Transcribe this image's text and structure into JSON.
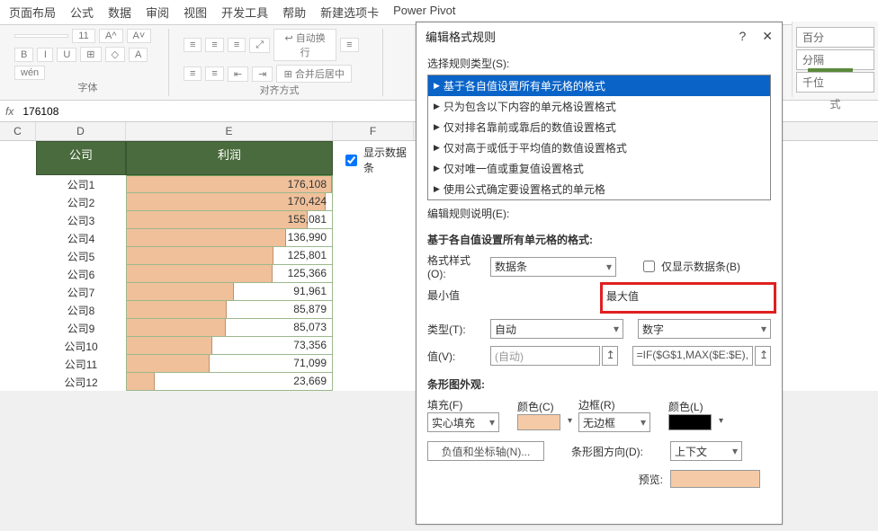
{
  "ribbon": {
    "tabs": [
      "页面布局",
      "公式",
      "数据",
      "审阅",
      "视图",
      "开发工具",
      "帮助",
      "新建选项卡",
      "Power Pivot"
    ],
    "group_font": "字体",
    "group_align": "对齐方式",
    "font_size": "11",
    "wrap_text": "自动换行",
    "merge_center": "合并后居中",
    "right_labels": [
      "百分",
      "分隔",
      "千位",
      "式"
    ]
  },
  "formula_bar": {
    "fx": "fx",
    "value": "176108"
  },
  "columns": {
    "c": "C",
    "d": "D",
    "e": "E",
    "f": "F"
  },
  "table": {
    "header_d": "公司",
    "header_e": "利润",
    "rows": [
      {
        "company": "公司1",
        "profit": "176,108",
        "pct": 100
      },
      {
        "company": "公司2",
        "profit": "170,424",
        "pct": 96.8
      },
      {
        "company": "公司3",
        "profit": "155,081",
        "pct": 88.1
      },
      {
        "company": "公司4",
        "profit": "136,990",
        "pct": 77.8
      },
      {
        "company": "公司5",
        "profit": "125,801",
        "pct": 71.4
      },
      {
        "company": "公司6",
        "profit": "125,366",
        "pct": 71.2
      },
      {
        "company": "公司7",
        "profit": "91,961",
        "pct": 52.2
      },
      {
        "company": "公司8",
        "profit": "85,879",
        "pct": 48.8
      },
      {
        "company": "公司9",
        "profit": "85,073",
        "pct": 48.3
      },
      {
        "company": "公司10",
        "profit": "73,356",
        "pct": 41.7
      },
      {
        "company": "公司11",
        "profit": "71,099",
        "pct": 40.4
      },
      {
        "company": "公司12",
        "profit": "23,669",
        "pct": 13.4
      }
    ]
  },
  "side_checkbox": "显示数据条",
  "dialog": {
    "title": "编辑格式规则",
    "select_rule_type": "选择规则类型(S):",
    "rule_types": [
      "基于各自值设置所有单元格的格式",
      "只为包含以下内容的单元格设置格式",
      "仅对排名靠前或靠后的数值设置格式",
      "仅对高于或低于平均值的数值设置格式",
      "仅对唯一值或重复值设置格式",
      "使用公式确定要设置格式的单元格"
    ],
    "edit_rule_desc": "编辑规则说明(E):",
    "subtitle": "基于各自值设置所有单元格的格式:",
    "format_style_lbl": "格式样式(O):",
    "format_style_val": "数据条",
    "show_bar_only": "仅显示数据条(B)",
    "min_label": "最小值",
    "max_label": "最大值",
    "type_lbl": "类型(T):",
    "type_min": "自动",
    "type_max": "数字",
    "value_lbl": "值(V):",
    "value_min": "(自动)",
    "value_max": "=IF($G$1,MAX($E:$E),",
    "bar_appearance": "条形图外观:",
    "fill_lbl": "填充(F)",
    "fill_val": "实心填充",
    "color_lbl": "颜色(C)",
    "border_lbl": "边框(R)",
    "border_val": "无边框",
    "border_color_lbl": "颜色(L)",
    "neg_axis_btn": "负值和坐标轴(N)...",
    "bar_dir_lbl": "条形图方向(D):",
    "bar_dir_val": "上下文",
    "preview_lbl": "预览:",
    "colors": {
      "fill": "#f5cba7",
      "border": "#000000"
    }
  }
}
